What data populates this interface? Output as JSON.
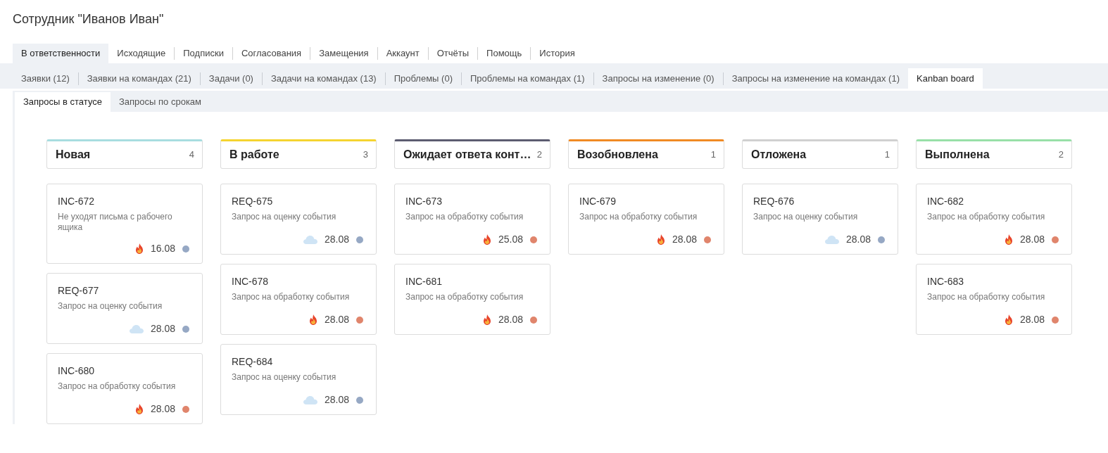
{
  "title": "Сотрудник \"Иванов Иван\"",
  "tabs": [
    {
      "label": "В ответственности",
      "selected": true
    },
    {
      "label": "Исходящие",
      "selected": false
    },
    {
      "label": "Подписки",
      "selected": false
    },
    {
      "label": "Согласования",
      "selected": false
    },
    {
      "label": "Замещения",
      "selected": false
    },
    {
      "label": "Аккаунт",
      "selected": false
    },
    {
      "label": "Отчёты",
      "selected": false
    },
    {
      "label": "Помощь",
      "selected": false
    },
    {
      "label": "История",
      "selected": false
    }
  ],
  "subtabs": [
    {
      "label": "Заявки (12)",
      "selected": false
    },
    {
      "label": "Заявки на командах (21)",
      "selected": false
    },
    {
      "label": "Задачи (0)",
      "selected": false
    },
    {
      "label": "Задачи на командах (13)",
      "selected": false
    },
    {
      "label": "Проблемы (0)",
      "selected": false
    },
    {
      "label": "Проблемы на командах (1)",
      "selected": false
    },
    {
      "label": "Запросы на изменение (0)",
      "selected": false
    },
    {
      "label": "Запросы на изменение на командах (1)",
      "selected": false
    },
    {
      "label": "Kanban board",
      "selected": true
    }
  ],
  "view_tabs": [
    {
      "label": "Запросы в статусе",
      "selected": true
    },
    {
      "label": "Запросы по срокам",
      "selected": false
    }
  ],
  "columns": [
    {
      "title": "Новая",
      "count": "4",
      "color": "#a8dde0",
      "cards": [
        {
          "id": "INC-672",
          "text": "Не уходят письма с рабочего ящика",
          "kind": "fire",
          "date": "16.08",
          "color": "#96a8c4"
        },
        {
          "id": "REQ-677",
          "text": "Запрос на оценку события",
          "kind": "cloud",
          "date": "28.08",
          "color": "#96a8c4"
        },
        {
          "id": "INC-680",
          "text": "Запрос на обработку события",
          "kind": "fire",
          "date": "28.08",
          "color": "#e0856c"
        }
      ]
    },
    {
      "title": "В работе",
      "count": "3",
      "color": "#f5d430",
      "cards": [
        {
          "id": "REQ-675",
          "text": "Запрос на оценку события",
          "kind": "cloud",
          "date": "28.08",
          "color": "#96a8c4"
        },
        {
          "id": "INC-678",
          "text": "Запрос на обработку события",
          "kind": "fire",
          "date": "28.08",
          "color": "#e0856c"
        },
        {
          "id": "REQ-684",
          "text": "Запрос на оценку события",
          "kind": "cloud",
          "date": "28.08",
          "color": "#96a8c4"
        }
      ]
    },
    {
      "title": "Ожидает ответа конт…",
      "count": "2",
      "color": "#5c5c70",
      "cards": [
        {
          "id": "INC-673",
          "text": "Запрос на обработку события",
          "kind": "fire",
          "date": "25.08",
          "color": "#e0856c"
        },
        {
          "id": "INC-681",
          "text": "Запрос на обработку события",
          "kind": "fire",
          "date": "28.08",
          "color": "#e0856c"
        }
      ]
    },
    {
      "title": "Возобновлена",
      "count": "1",
      "color": "#f08a24",
      "cards": [
        {
          "id": "INC-679",
          "text": "Запрос на обработку события",
          "kind": "fire",
          "date": "28.08",
          "color": "#e0856c"
        }
      ]
    },
    {
      "title": "Отложена",
      "count": "1",
      "color": "#d0d0d0",
      "cards": [
        {
          "id": "REQ-676",
          "text": "Запрос на оценку события",
          "kind": "cloud",
          "date": "28.08",
          "color": "#96a8c4"
        }
      ]
    },
    {
      "title": "Выполнена",
      "count": "2",
      "color": "#98e0a8",
      "cards": [
        {
          "id": "INC-682",
          "text": "Запрос на обработку события",
          "kind": "fire",
          "date": "28.08",
          "color": "#e0856c"
        },
        {
          "id": "INC-683",
          "text": "Запрос на обработку события",
          "kind": "fire",
          "date": "28.08",
          "color": "#e0856c"
        }
      ]
    }
  ]
}
